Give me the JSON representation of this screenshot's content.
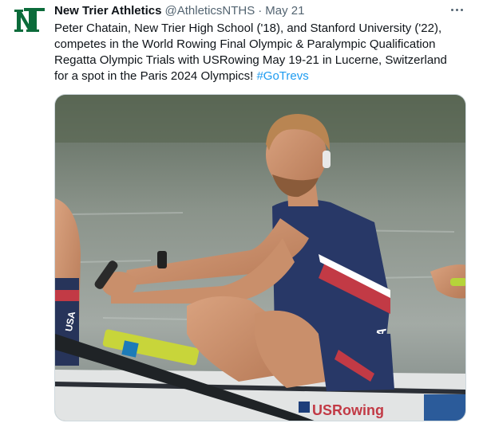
{
  "tweet": {
    "author": {
      "display_name": "New Trier Athletics",
      "handle": "@AthleticsNTHS",
      "separator": "·",
      "date": "May 21",
      "avatar_icon": "nt-logo-icon",
      "avatar_color": "#0b6b3a"
    },
    "text_lines": [
      "Peter Chatain, New Trier High School ('18), and Stanford University ('22),",
      "competes in the World Rowing Final Olympic & Paralympic Qualification",
      "Regatta Olympic Trials with USRowing May 19-21 in Lucerne, Switzerland",
      "for a spot in the Paris 2024 Olympics!"
    ],
    "hashtag": "#GoTrevs",
    "hashtag_color": "#1d9bf0",
    "more_icon": "more-options-icon",
    "photo": {
      "description_icon": "rowing-photo",
      "visible_texts": [
        "USA",
        "USA",
        "USRowing"
      ]
    }
  }
}
